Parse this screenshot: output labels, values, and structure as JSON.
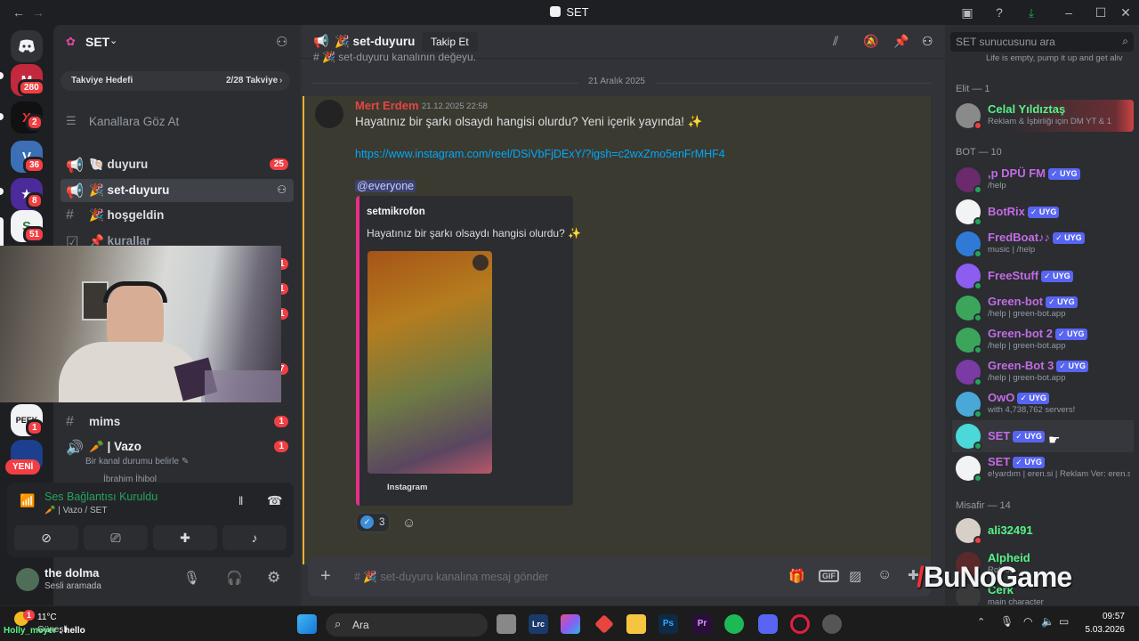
{
  "titlebar": {
    "title": "SET"
  },
  "rail": {
    "badges": [
      "280",
      "2",
      "36",
      "8",
      "51",
      "1"
    ],
    "new_label": "YENİ"
  },
  "sidebar": {
    "server_name": "SET",
    "boost_label": "Takviye Hedefi",
    "boost_progress": "2/28 Takviye",
    "browse_channels": "Kanallara Göz At",
    "channels": [
      {
        "name": "🐚 duyuru",
        "badge": "25"
      },
      {
        "name": "🎉 set-duyuru",
        "badge": ""
      },
      {
        "name": "🎉 hoşgeldin",
        "badge": ""
      },
      {
        "name": "📌 kurallar",
        "badge": ""
      },
      {
        "name": "mims",
        "badge": "1"
      },
      {
        "name": "🥕 | Vazo",
        "badge": "1"
      }
    ],
    "hidden_badges": [
      "1",
      "1",
      "1",
      "7"
    ],
    "voice_status_placeholder": "Bir kanal durumu belirle",
    "voice_member": "İbrahim İhibol"
  },
  "voice_panel": {
    "title": "Ses Bağlantısı Kuruldu",
    "subtitle": "🥕 | Vazo / SET"
  },
  "user": {
    "name": "the dolma",
    "status": "Sesli aramada"
  },
  "header": {
    "channel": "🎉 set-duyuru",
    "follow": "Takip Et"
  },
  "chat": {
    "top_snippet": "# 🎉 set-duyuru kanalının değeyu.",
    "date": "21 Aralık 2025",
    "author": "Mert Erdem",
    "timestamp": "21.12.2025 22:58",
    "text": "Hayatınız bir şarkı olsaydı hangisi olurdu? Yeni içerik yayında! ✨",
    "link": "https://www.instagram.com/reel/DSiVbFjDExY/?igsh=c2wxZmo5enFrMHF4",
    "mention": "@everyone",
    "embed": {
      "provider": "setmikrofon",
      "description": "Hayatınız bir şarkı olsaydı hangisi olurdu? ✨",
      "footer": "Instagram"
    },
    "reaction_count": "3",
    "composer_placeholder": "# 🎉 set-duyuru kanalına mesaj gönder"
  },
  "members": {
    "search_placeholder": "SET sunucusunu ara",
    "top_snippet": "Life is empty, pump it up and get aliv",
    "groups": [
      {
        "title": "Elit — 1",
        "items": [
          {
            "name": "Celal Yıldıztaş",
            "sub": "Reklam & İşbirliği için DM YT & 1",
            "color": "#57f287",
            "app": false
          }
        ]
      },
      {
        "title": "BOT — 10",
        "items": [
          {
            "name": ",p DPÜ FM",
            "sub": "/help",
            "color": "#c36be6",
            "app": true
          },
          {
            "name": "BotRix",
            "sub": "",
            "color": "#c36be6",
            "app": true
          },
          {
            "name": "FredBoat♪♪",
            "sub": "music | /help",
            "color": "#c36be6",
            "app": true
          },
          {
            "name": "FreeStuff",
            "sub": "",
            "color": "#c36be6",
            "app": true
          },
          {
            "name": "Green-bot",
            "sub": "/help | green-bot.app",
            "color": "#c36be6",
            "app": true
          },
          {
            "name": "Green-bot 2",
            "sub": "/help | green-bot.app",
            "color": "#c36be6",
            "app": true
          },
          {
            "name": "Green-Bot 3",
            "sub": "/help | green-bot.app",
            "color": "#c36be6",
            "app": true
          },
          {
            "name": "OwO",
            "sub": "with 4,738,762 servers!",
            "color": "#c36be6",
            "app": true
          },
          {
            "name": "SET",
            "sub": "",
            "color": "#c36be6",
            "app": true
          },
          {
            "name": "SET",
            "sub": "e!yardım | eren.si | Reklam Ver: eren.s",
            "color": "#c36be6",
            "app": true
          }
        ]
      },
      {
        "title": "Misafir — 14",
        "items": [
          {
            "name": "ali32491",
            "sub": "",
            "color": "#57f287",
            "app": false
          },
          {
            "name": "Alpheid",
            "sub": "Roblox",
            "color": "#57f287",
            "app": false
          },
          {
            "name": "Cerk",
            "sub": "main character",
            "color": "#57f287",
            "app": false
          }
        ]
      }
    ],
    "app_badge": "✓ UYG"
  },
  "overlay": {
    "watermark": "BuNoGame",
    "chat_user": "Holly_meyer",
    "chat_text": "hello"
  },
  "taskbar": {
    "weather_temp": "11°C",
    "weather_text": "Güneşli",
    "search_label": "Ara",
    "time": "09:57",
    "date": "5.03.2026",
    "notif_count": "1"
  }
}
